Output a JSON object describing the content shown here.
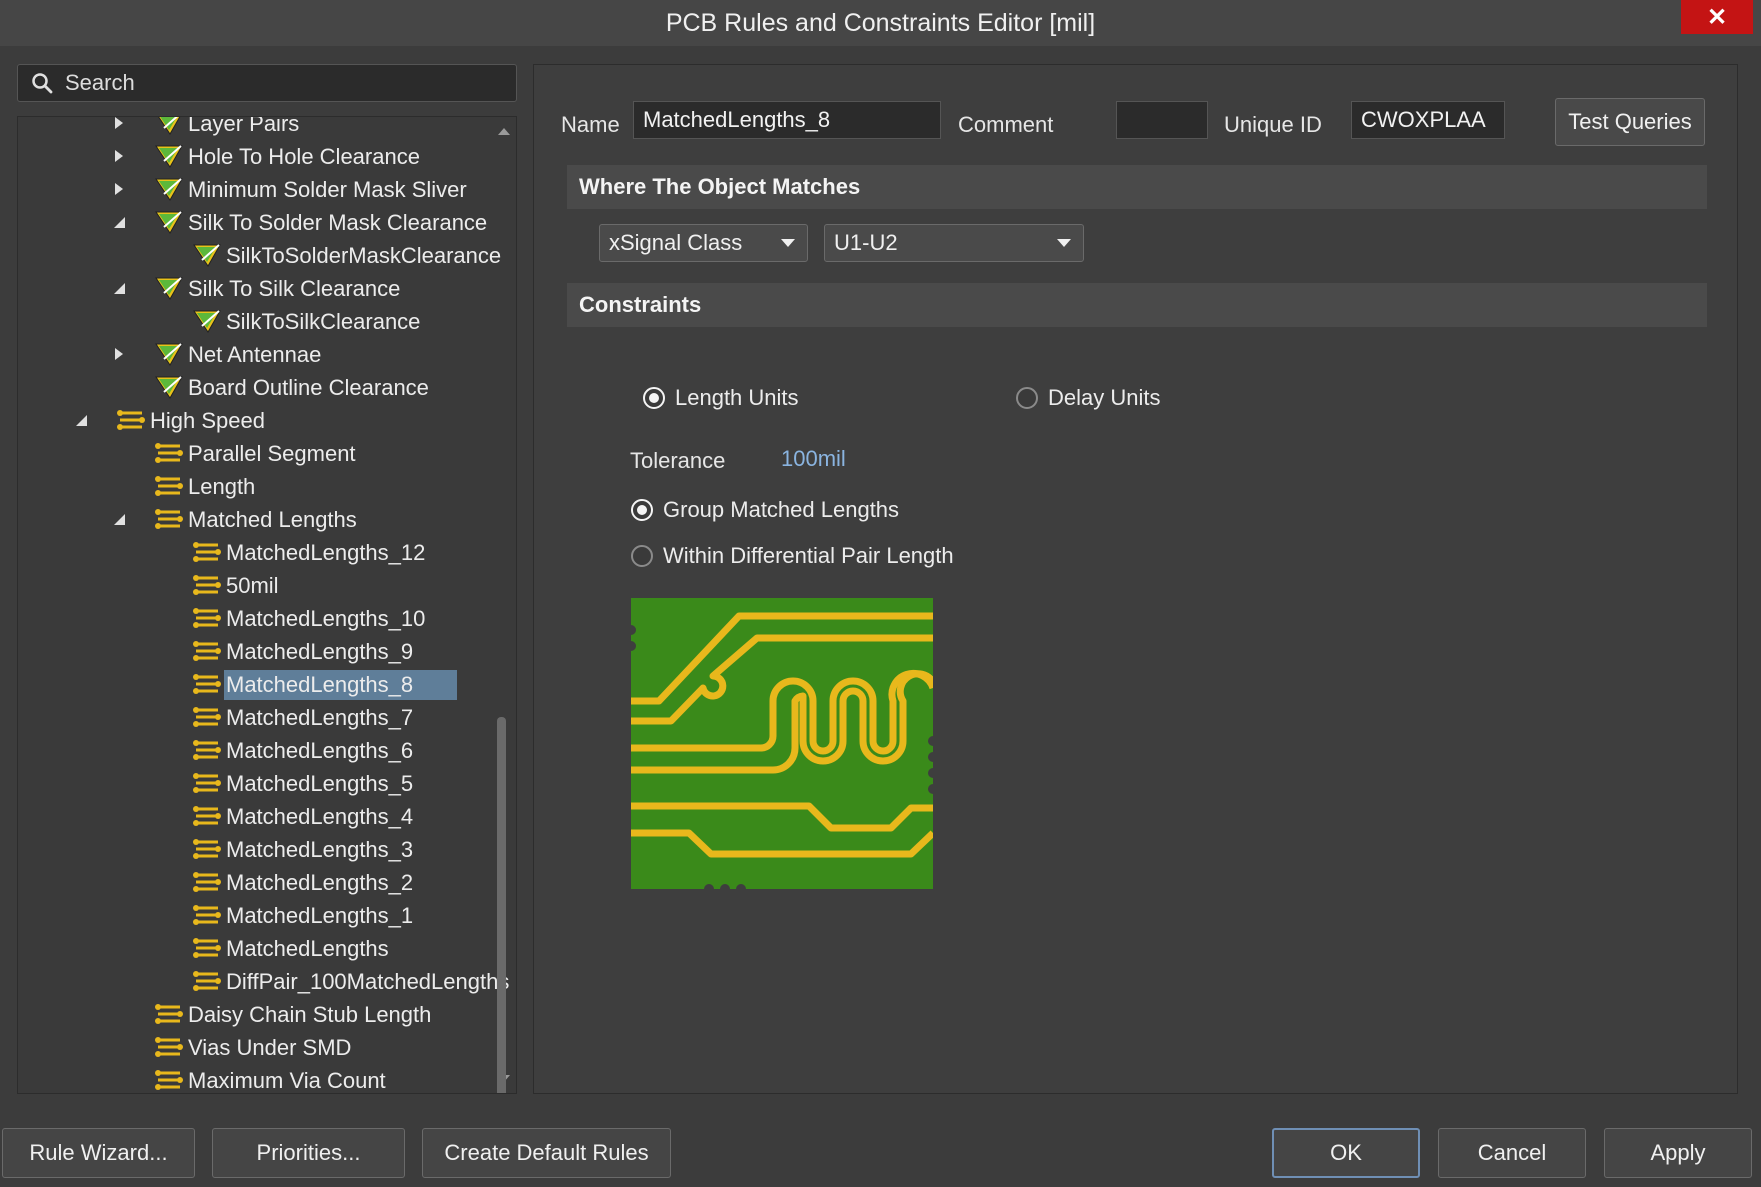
{
  "window": {
    "title": "PCB Rules and Constraints Editor [mil]",
    "close_label": "✕"
  },
  "search": {
    "placeholder": "Search"
  },
  "tree": {
    "items": [
      {
        "label": "Layer Pairs",
        "arrow": "right",
        "icon": "rule-filter-icon"
      },
      {
        "label": "Hole To Hole Clearance",
        "arrow": "right",
        "icon": "rule-filter-icon"
      },
      {
        "label": "Minimum Solder Mask Sliver",
        "arrow": "right",
        "icon": "rule-filter-icon"
      },
      {
        "label": "Silk To Solder Mask Clearance",
        "arrow": "down",
        "icon": "rule-filter-icon"
      },
      {
        "label": "SilkToSolderMaskClearance",
        "arrow": "",
        "icon": "rule-filter-icon"
      },
      {
        "label": "Silk To Silk Clearance",
        "arrow": "down",
        "icon": "rule-filter-icon"
      },
      {
        "label": "SilkToSilkClearance",
        "arrow": "",
        "icon": "rule-filter-icon"
      },
      {
        "label": "Net Antennae",
        "arrow": "right",
        "icon": "rule-filter-icon"
      },
      {
        "label": "Board Outline Clearance",
        "arrow": "",
        "icon": "rule-filter-icon"
      },
      {
        "label": "High Speed",
        "arrow": "down",
        "icon": "high-speed-icon"
      },
      {
        "label": "Parallel Segment",
        "arrow": "",
        "icon": "high-speed-icon"
      },
      {
        "label": "Length",
        "arrow": "",
        "icon": "high-speed-icon"
      },
      {
        "label": "Matched Lengths",
        "arrow": "down",
        "icon": "high-speed-icon"
      },
      {
        "label": "MatchedLengths_12",
        "arrow": "",
        "icon": "high-speed-icon"
      },
      {
        "label": "50mil",
        "arrow": "",
        "icon": "high-speed-icon"
      },
      {
        "label": "MatchedLengths_10",
        "arrow": "",
        "icon": "high-speed-icon"
      },
      {
        "label": "MatchedLengths_9",
        "arrow": "",
        "icon": "high-speed-icon"
      },
      {
        "label": "MatchedLengths_8",
        "arrow": "",
        "icon": "high-speed-icon",
        "selected": true
      },
      {
        "label": "MatchedLengths_7",
        "arrow": "",
        "icon": "high-speed-icon"
      },
      {
        "label": "MatchedLengths_6",
        "arrow": "",
        "icon": "high-speed-icon"
      },
      {
        "label": "MatchedLengths_5",
        "arrow": "",
        "icon": "high-speed-icon"
      },
      {
        "label": "MatchedLengths_4",
        "arrow": "",
        "icon": "high-speed-icon"
      },
      {
        "label": "MatchedLengths_3",
        "arrow": "",
        "icon": "high-speed-icon"
      },
      {
        "label": "MatchedLengths_2",
        "arrow": "",
        "icon": "high-speed-icon"
      },
      {
        "label": "MatchedLengths_1",
        "arrow": "",
        "icon": "high-speed-icon"
      },
      {
        "label": "MatchedLengths",
        "arrow": "",
        "icon": "high-speed-icon"
      },
      {
        "label": "DiffPair_100MatchedLengths",
        "arrow": "",
        "icon": "high-speed-icon"
      },
      {
        "label": "Daisy Chain Stub Length",
        "arrow": "",
        "icon": "high-speed-icon"
      },
      {
        "label": "Vias Under SMD",
        "arrow": "",
        "icon": "high-speed-icon"
      },
      {
        "label": "Maximum Via Count",
        "arrow": "",
        "icon": "high-speed-icon"
      }
    ]
  },
  "rule": {
    "name_label": "Name",
    "name_value": "MatchedLengths_8",
    "comment_label": "Comment",
    "comment_value": "",
    "unique_id_label": "Unique ID",
    "unique_id_value": "CWOXPLAA",
    "test_queries_label": "Test Queries"
  },
  "where_matches": {
    "header": "Where The Object Matches",
    "type_value": "xSignal Class",
    "class_value": "U1-U2"
  },
  "constraints": {
    "header": "Constraints",
    "length_units_label": "Length Units",
    "delay_units_label": "Delay Units",
    "units_selected": "length",
    "tolerance_label": "Tolerance",
    "tolerance_value": "100mil",
    "group_matched_label": "Group Matched Lengths",
    "within_diff_pair_label": "Within Differential Pair Length",
    "mode_selected": "group"
  },
  "footer": {
    "rule_wizard": "Rule Wizard...",
    "priorities": "Priorities...",
    "create_default_rules": "Create Default Rules",
    "ok": "OK",
    "cancel": "Cancel",
    "apply": "Apply"
  },
  "colors": {
    "pcb_green": "#3a8a1a",
    "trace_yellow": "#e8b81c",
    "selection": "#5f7e99",
    "close_red": "#c41414"
  }
}
